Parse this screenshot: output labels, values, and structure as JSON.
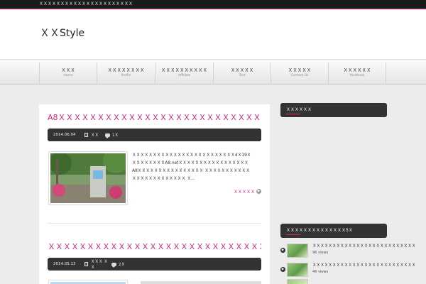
{
  "topbar": {
    "tagline": "ＸＸＸＸＸＸＸＸＸＸＸＸＸＸＸＸＸＸＸＸＸＸ"
  },
  "header": {
    "site_title": "ＸＸStyle"
  },
  "nav": {
    "items": [
      {
        "label": "ＸＸＸ",
        "sub": "Home"
      },
      {
        "label": "ＸＸＸＸＸＸＸＸ",
        "sub": "Profile"
      },
      {
        "label": "ＸＸＸＸＸＸＸＸＸＸ",
        "sub": "Affiliate"
      },
      {
        "label": "ＸＸＸＸＸ",
        "sub": "Text"
      },
      {
        "label": "ＸＸＸＸＸ",
        "sub": "Contact Us"
      },
      {
        "label": "ＸＸＸＸＸＸ",
        "sub": "facebook"
      }
    ]
  },
  "posts": [
    {
      "title": "A8ＸＸＸＸＸＸＸＸＸＸＸＸＸＸＸＸＸＸＸＸＸＸＸＸＸＸＸＸＸＸＸＸＸＸＸＸＸＸＸＸ",
      "date": "2014.06.04",
      "category": "ＸＸ",
      "comments": "1Ｘ",
      "excerpt": "ＸＸＸＸＸＸＸＸＸＸＸＸＸＸＸＸＸＸＸＸＸＸＸＸＸ4Ｘ19ＸＸＸＸＸＸＸＸＸA8.netＸＸＸＸＸＸＸＸＸＸＸＸＸＸＸＸＸA8ＸＸＸＸＸＸＸＸＸＸＸＸＸＸＸＸ ＸＸＸＸＸＸＸＸＸＸＸＸＸＸＸＸＸＸＸＸＸＸＸＸ Ｘ…",
      "more_label": "ＸＸＸＸＸ"
    },
    {
      "title": "ＸＸＸＸＸＸＸＸＸＸＸＸＸＸＸＸＸＸＸＸＸＸＸＸＸＸＸＸＸＸＸＸＸＸＸＸＸＸＸＸＸＸ",
      "date": "2014.05.13",
      "category": "ＸＸＸ ＸＸ",
      "comments": "2Ｘ"
    }
  ],
  "sidebar": {
    "widget1_title": "ＸＸＸＸＸＸ",
    "widget2_title": "ＸＸＸＸＸＸＸＸＸＸＸＸＸＸ5Ｘ",
    "popular": [
      {
        "title": "ＸＸＸＸＸＸＸＸＸＸＸＸＸＸＸＸＸＸＸＸＸＸＸＸＸＸ",
        "views": "96 views"
      },
      {
        "title": "ＸＸＸＸＸＸＸＸＸＸＸＸＸＸＸＸＸＸＸＸＸＸＸＸＸＸ",
        "views": "46 views"
      }
    ]
  },
  "colors": {
    "accent": "#d51f7a",
    "dark_bar": "#333333",
    "background": "#ececec"
  }
}
